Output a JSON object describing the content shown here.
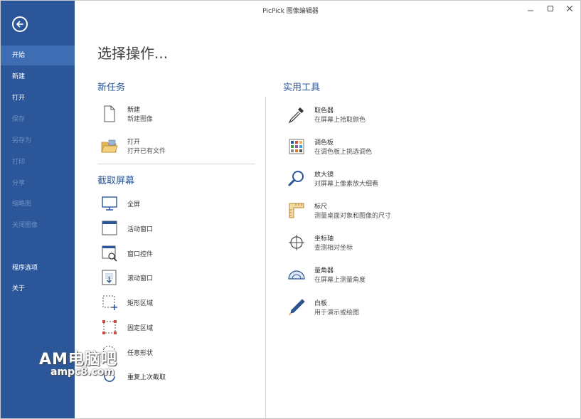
{
  "window": {
    "title": "PicPick 图像编辑器"
  },
  "sidebar": {
    "items": [
      {
        "label": "开始",
        "state": "active"
      },
      {
        "label": "新建",
        "state": "normal"
      },
      {
        "label": "打开",
        "state": "normal"
      },
      {
        "label": "保存",
        "state": "disabled"
      },
      {
        "label": "另存为",
        "state": "disabled"
      },
      {
        "label": "打印",
        "state": "disabled"
      },
      {
        "label": "分享",
        "state": "disabled"
      },
      {
        "label": "缩略图",
        "state": "disabled"
      },
      {
        "label": "关闭图像",
        "state": "disabled"
      },
      {
        "label": "程序选项",
        "state": "normal"
      },
      {
        "label": "关于",
        "state": "normal"
      }
    ]
  },
  "main": {
    "heading": "选择操作...",
    "new_tasks": {
      "title": "新任务",
      "items": [
        {
          "label": "新建",
          "desc": "新建图像",
          "icon": "new-file-icon"
        },
        {
          "label": "打开",
          "desc": "打开已有文件",
          "icon": "open-folder-icon"
        }
      ]
    },
    "capture": {
      "title": "截取屏幕",
      "items": [
        {
          "label": "全屏",
          "icon": "monitor-icon"
        },
        {
          "label": "活动窗口",
          "icon": "window-icon"
        },
        {
          "label": "窗口控件",
          "icon": "window-control-icon"
        },
        {
          "label": "滚动窗口",
          "icon": "scroll-window-icon"
        },
        {
          "label": "矩形区域",
          "icon": "rect-region-icon"
        },
        {
          "label": "固定区域",
          "icon": "fixed-region-icon"
        },
        {
          "label": "任意形状",
          "icon": "freehand-icon"
        },
        {
          "label": "重复上次截取",
          "icon": "repeat-icon"
        }
      ]
    },
    "tools": {
      "title": "实用工具",
      "items": [
        {
          "label": "取色器",
          "desc": "在屏幕上拾取颜色",
          "icon": "eyedropper-icon"
        },
        {
          "label": "调色板",
          "desc": "在调色板上挑选调色",
          "icon": "palette-icon"
        },
        {
          "label": "放大镜",
          "desc": "对屏幕上像素放大细看",
          "icon": "magnifier-icon"
        },
        {
          "label": "标尺",
          "desc": "测量桌面对象和图像的尺寸",
          "icon": "ruler-icon"
        },
        {
          "label": "坐标轴",
          "desc": "查测相对坐标",
          "icon": "crosshair-icon"
        },
        {
          "label": "量角器",
          "desc": "在屏幕上测量角度",
          "icon": "protractor-icon"
        },
        {
          "label": "白板",
          "desc": "用于演示或绘图",
          "icon": "pen-icon"
        }
      ]
    }
  },
  "watermark": {
    "line1": "AM电脑吧",
    "line2": "ampc8.com"
  },
  "colors": {
    "sidebar": "#2b579a",
    "sidebar_active": "#3f6db3",
    "accent": "#2b579a"
  }
}
